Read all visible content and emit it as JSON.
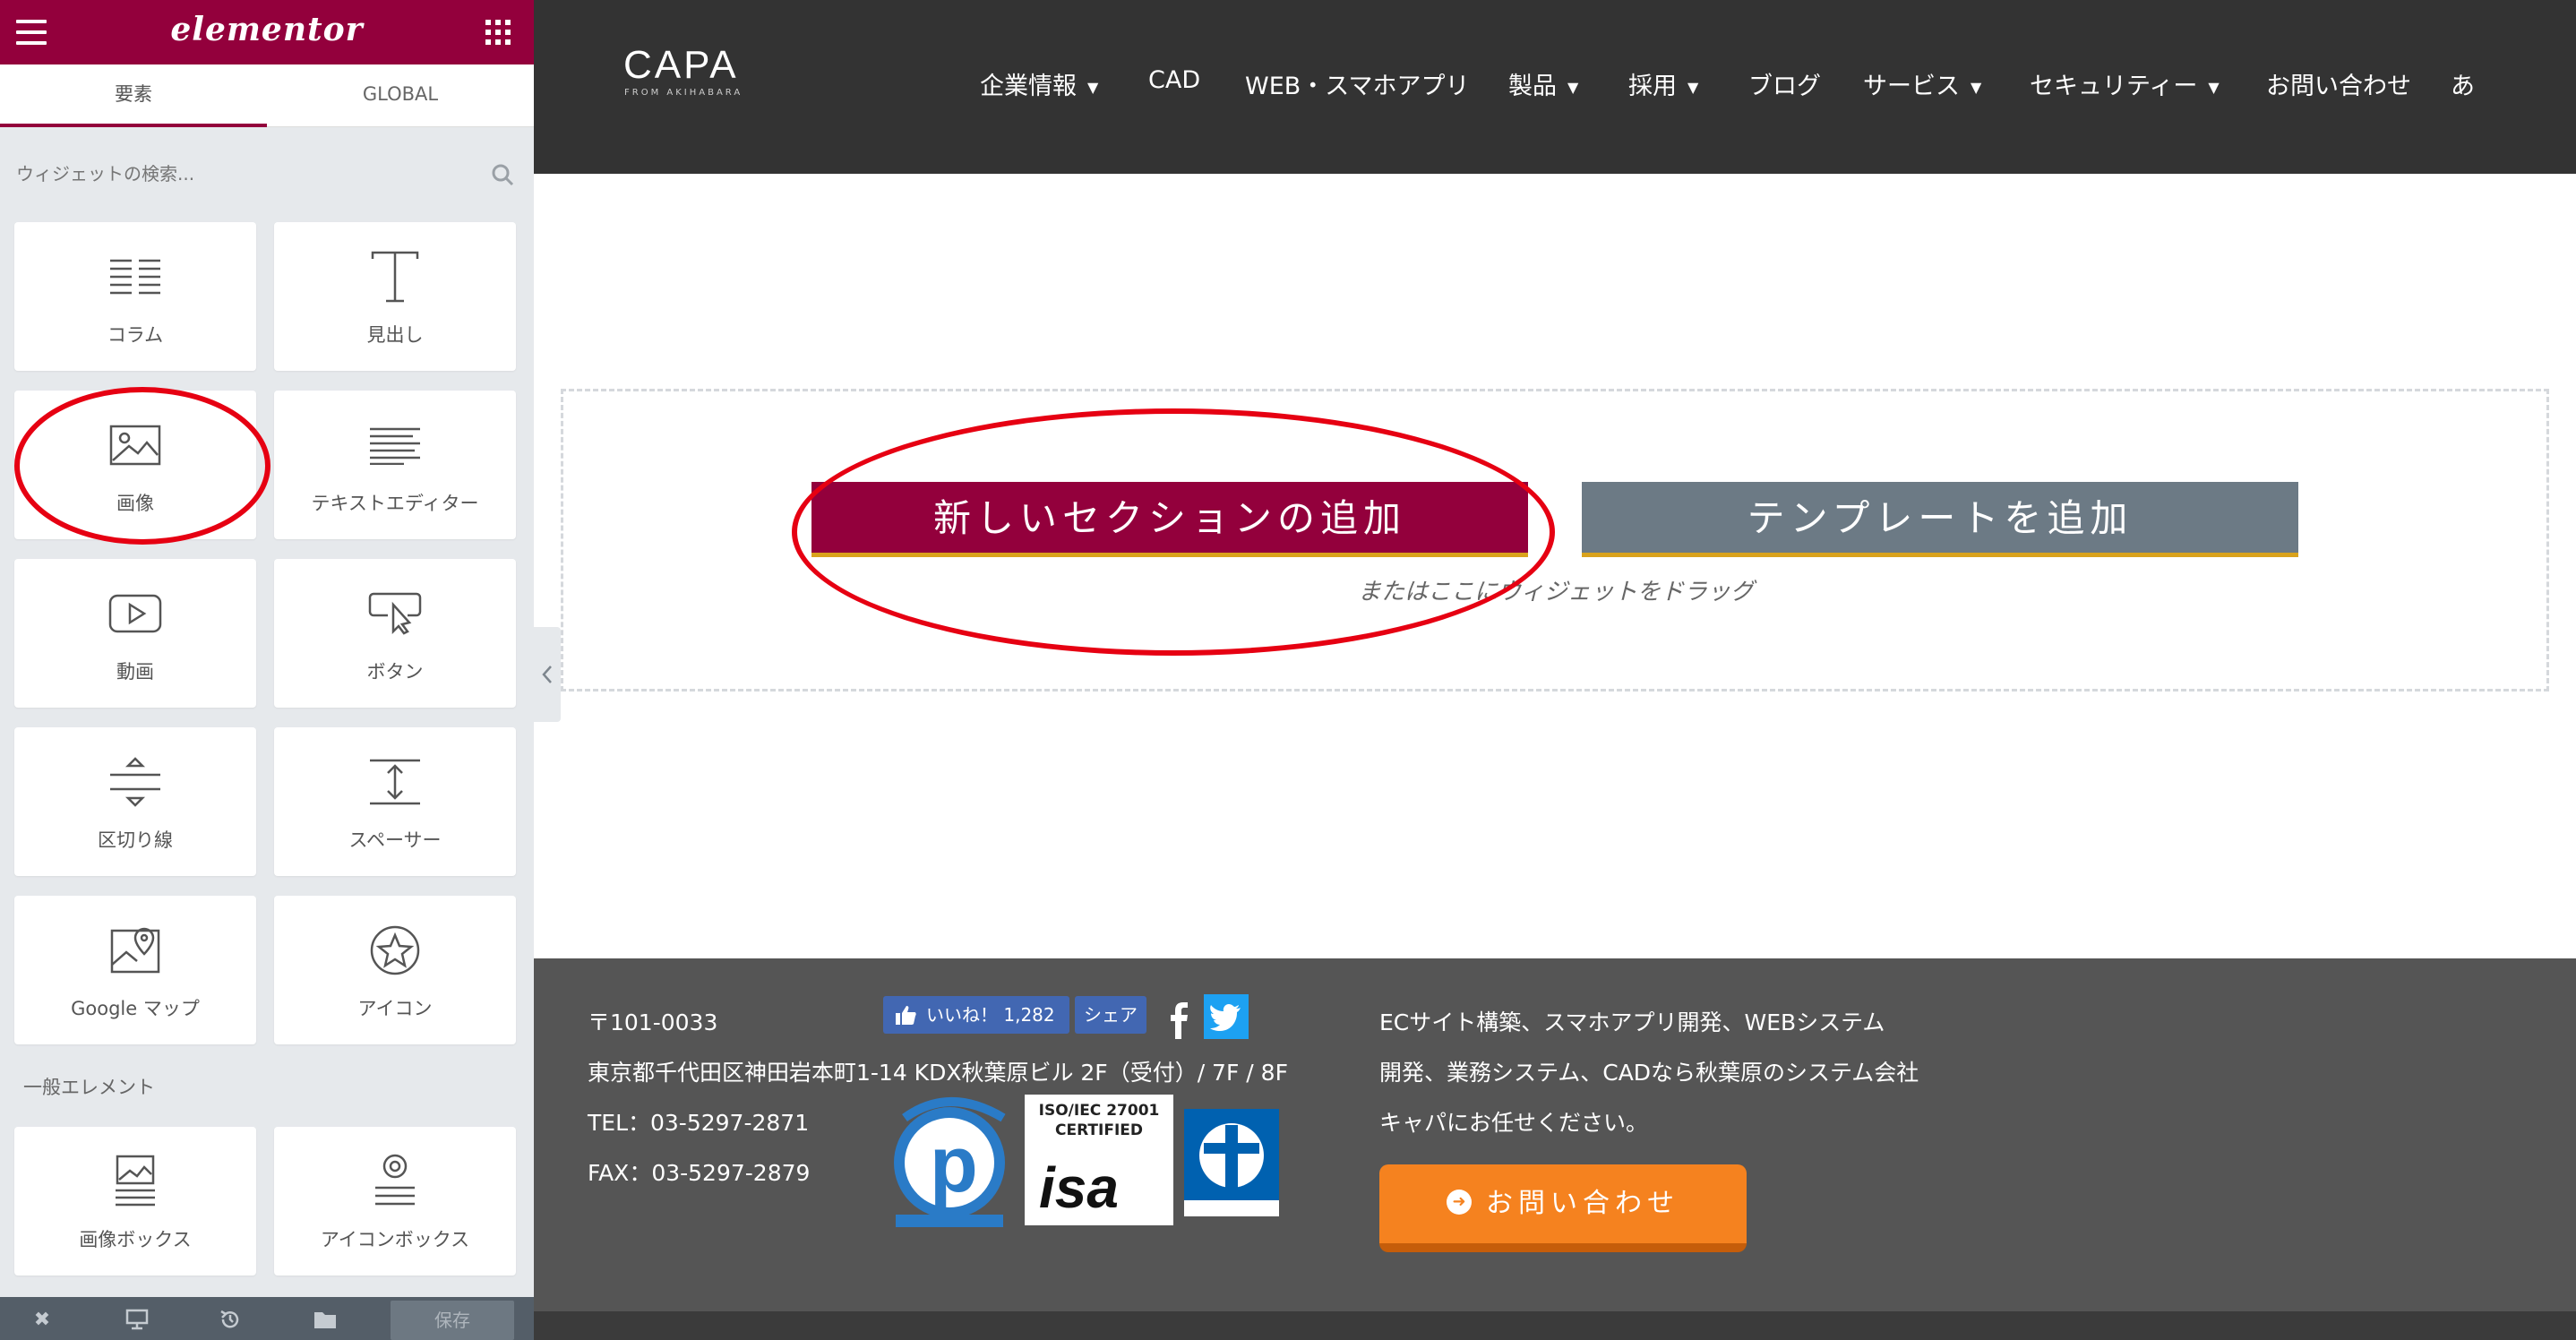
{
  "sidebar": {
    "logo": "elementor",
    "tabs": [
      {
        "label": "要素"
      },
      {
        "label": "GLOBAL"
      }
    ],
    "search": {
      "placeholder": "ウィジェットの検索..."
    },
    "widgets": [
      {
        "label": "コラム",
        "icon": "columns-icon"
      },
      {
        "label": "見出し",
        "icon": "heading-icon"
      },
      {
        "label": "画像",
        "icon": "image-icon"
      },
      {
        "label": "テキストエディター",
        "icon": "text-editor-icon"
      },
      {
        "label": "動画",
        "icon": "video-icon"
      },
      {
        "label": "ボタン",
        "icon": "button-icon"
      },
      {
        "label": "区切り線",
        "icon": "divider-icon"
      },
      {
        "label": "スペーサー",
        "icon": "spacer-icon"
      },
      {
        "label": "Google マップ",
        "icon": "google-maps-icon"
      },
      {
        "label": "アイコン",
        "icon": "star-icon"
      }
    ],
    "section_title": "一般エレメント",
    "general_widgets": [
      {
        "label": "画像ボックス",
        "icon": "image-box-icon"
      },
      {
        "label": "アイコンボックス",
        "icon": "icon-box-icon"
      }
    ],
    "footer": {
      "save_label": "保存"
    }
  },
  "header": {
    "logo": "CAPA",
    "logo_sub": "FROM AKIHABARA",
    "nav": [
      {
        "label": "企業情報",
        "dropdown": true
      },
      {
        "label": "CAD",
        "dropdown": false
      },
      {
        "label": "WEB・スマホアプリ",
        "dropdown": false
      },
      {
        "label": "製品",
        "dropdown": true
      },
      {
        "label": "採用",
        "dropdown": true
      },
      {
        "label": "ブログ",
        "dropdown": false
      },
      {
        "label": "サービス",
        "dropdown": true
      },
      {
        "label": "セキュリティー",
        "dropdown": true
      },
      {
        "label": "お問い合わせ",
        "dropdown": false
      },
      {
        "label": "あ",
        "dropdown": false
      }
    ]
  },
  "canvas": {
    "add_section_label": "新しいセクションの追加",
    "add_template_label": "テンプレートを追加",
    "drop_hint": "またはここにウィジェットをドラッグ"
  },
  "footer": {
    "postal": "〒101-0033",
    "address": "東京都千代田区神田岩本町1-14 KDX秋葉原ビル 2F（受付）/ 7F / 8F",
    "tel": "TEL：03-5297-2871",
    "fax": "FAX：03-5297-2879",
    "fb_like": "いいね！ 1,282",
    "fb_share": "シェア",
    "isa_line1": "ISO/IEC 27001",
    "isa_line2": "CERTIFIED",
    "tagline": [
      "ECサイト構築、スマホアプリ開発、WEBシステム",
      "開発、業務システム、CADなら秋葉原のシステム会社",
      "キャパにお任せください。"
    ],
    "contact_label": "お問い合わせ"
  },
  "colors": {
    "brand": "#93003c",
    "template_button": "#6c7a85",
    "button_underline": "#d9a21c",
    "header_bg": "#333333",
    "footer_bg": "#555555",
    "contact_orange": "#f5821f",
    "annotation_red": "#e60012"
  }
}
